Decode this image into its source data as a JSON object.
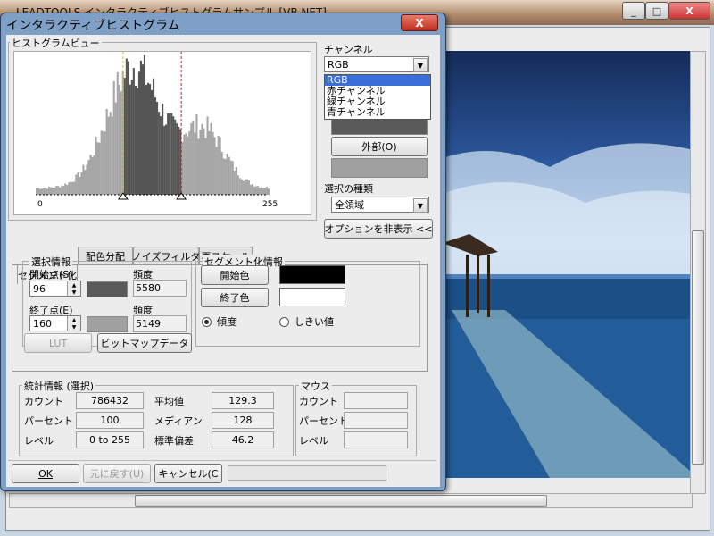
{
  "main_window": {
    "title": "LEADTOOLS インタラクティブヒストグラムサンプル [VB.NET]",
    "min_label": "_",
    "max_label": "□",
    "close_label": "X"
  },
  "dialog": {
    "title": "インタラクティブヒストグラム",
    "close_label": "X",
    "histogram_view": {
      "legend": "ヒストグラムビュー",
      "axis_min": "0",
      "axis_max": "255",
      "start": 96,
      "end": 160
    },
    "channel": {
      "label": "チャンネル",
      "selected": "RGB",
      "options": [
        "RGB",
        "赤チャンネル",
        "緑チャンネル",
        "青チャンネル"
      ],
      "external_button": "外部(O)"
    },
    "selection_type": {
      "label": "選択の種類",
      "selected": "全領域"
    },
    "hide_options_button": "オプションを非表示 <<",
    "tabs": [
      "セグメント化",
      "配色分配",
      "ノイズフィルタ",
      "再スケール"
    ],
    "selection_info": {
      "legend": "選択情報",
      "start_label": "開始点(S)",
      "start_value": "96",
      "start_freq_label": "頻度",
      "start_freq": "5580",
      "end_label": "終了点(E)",
      "end_value": "160",
      "end_freq_label": "頻度",
      "end_freq": "5149",
      "start_swatch_color": "#5a5a5a",
      "end_swatch_color": "#a0a0a0"
    },
    "segmentation_info": {
      "legend": "セグメント化情報",
      "start_color_button": "開始色",
      "end_color_button": "終了色",
      "start_color": "#000000",
      "end_color": "#ffffff",
      "radio_gradient": "傾度",
      "radio_threshold": "しきい値"
    },
    "lut_button": "LUT",
    "bitmap_data_button": "ビットマップデータ",
    "stats": {
      "legend": "統計情報 (選択)",
      "count_label": "カウント",
      "count_value": "786432",
      "percent_label": "パーセント",
      "percent_value": "100",
      "level_label": "レベル",
      "level_value": "0 to 255",
      "mean_label": "平均値",
      "mean_value": "129.3",
      "median_label": "メディアン",
      "median_value": "128",
      "stddev_label": "標準偏差",
      "stddev_value": "46.2"
    },
    "mouse": {
      "legend": "マウス",
      "count_label": "カウント",
      "percent_label": "パーセント",
      "level_label": "レベル"
    },
    "ok_button": "OK",
    "undo_button": "元に戻す(U)",
    "cancel_button": "キャンセル(C"
  }
}
